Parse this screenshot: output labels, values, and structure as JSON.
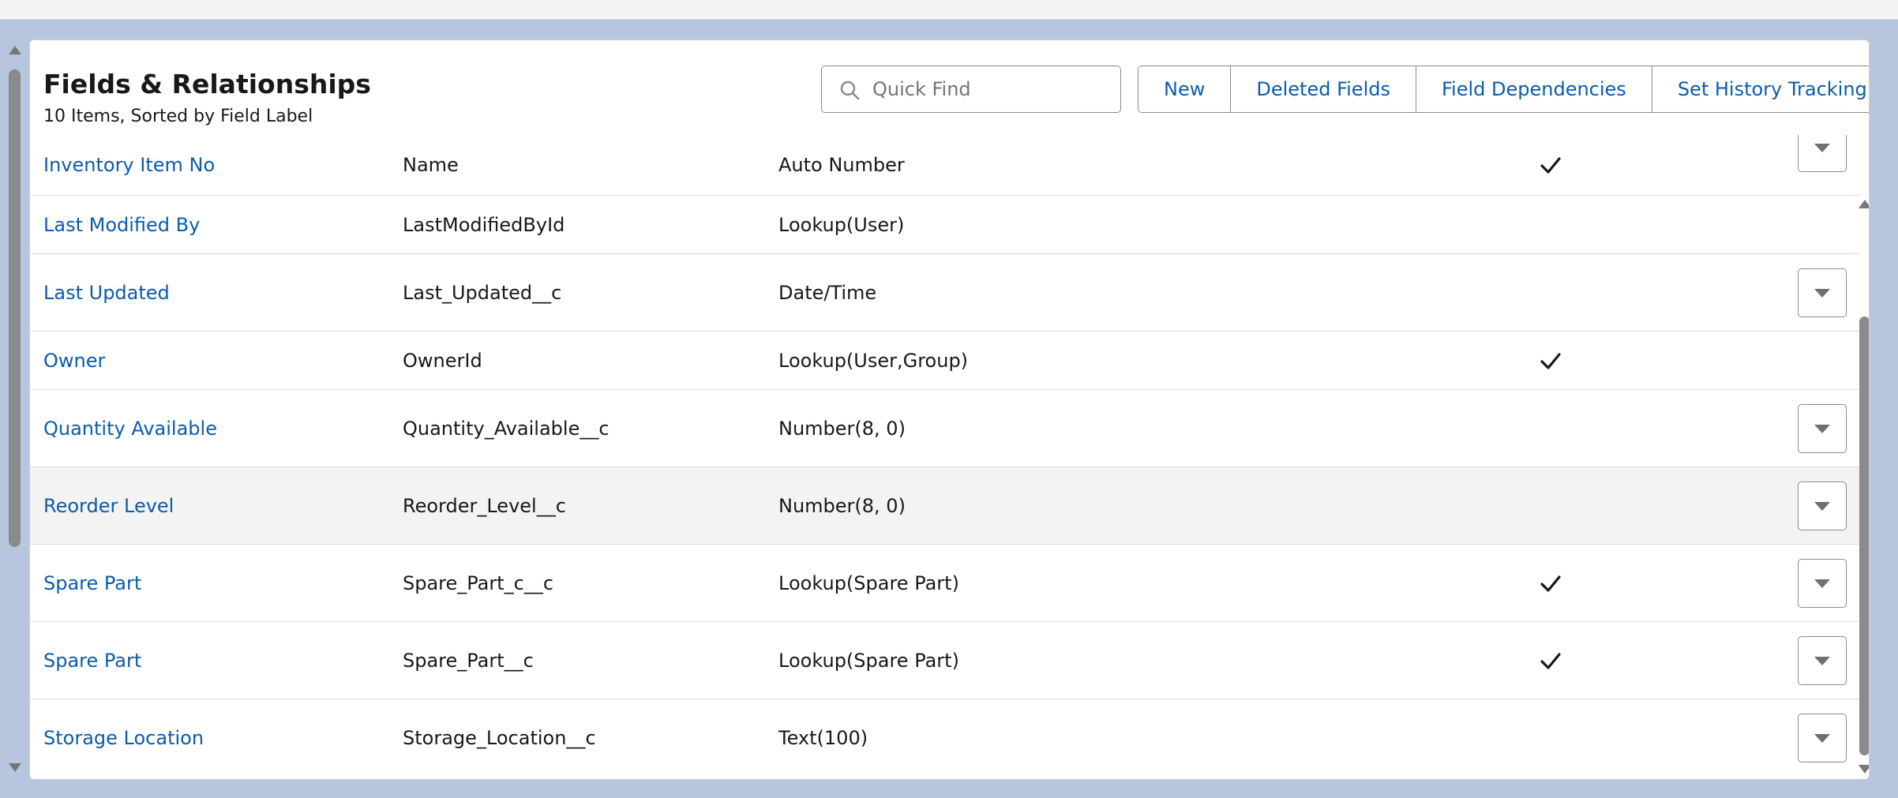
{
  "header": {
    "title": "Fields & Relationships",
    "subtitle": "10 Items, Sorted by Field Label"
  },
  "search": {
    "placeholder": "Quick Find",
    "value": ""
  },
  "buttons": {
    "new": "New",
    "deleted_fields": "Deleted Fields",
    "field_dependencies": "Field Dependencies",
    "set_history_tracking": "Set History Tracking"
  },
  "rows": [
    {
      "label": "Inventory Item No",
      "api": "Name",
      "type": "Auto Number",
      "indexed": true,
      "menu": true
    },
    {
      "label": "Last Modified By",
      "api": "LastModifiedById",
      "type": "Lookup(User)",
      "indexed": false,
      "menu": false
    },
    {
      "label": "Last Updated",
      "api": "Last_Updated__c",
      "type": "Date/Time",
      "indexed": false,
      "menu": true
    },
    {
      "label": "Owner",
      "api": "OwnerId",
      "type": "Lookup(User,Group)",
      "indexed": true,
      "menu": false
    },
    {
      "label": "Quantity Available",
      "api": "Quantity_Available__c",
      "type": "Number(8, 0)",
      "indexed": false,
      "menu": true
    },
    {
      "label": "Reorder Level",
      "api": "Reorder_Level__c",
      "type": "Number(8, 0)",
      "indexed": false,
      "menu": true
    },
    {
      "label": "Spare Part",
      "api": "Spare_Part_c__c",
      "type": "Lookup(Spare Part)",
      "indexed": true,
      "menu": true
    },
    {
      "label": "Spare Part",
      "api": "Spare_Part__c",
      "type": "Lookup(Spare Part)",
      "indexed": true,
      "menu": true
    },
    {
      "label": "Storage Location",
      "api": "Storage_Location__c",
      "type": "Text(100)",
      "indexed": false,
      "menu": true
    }
  ],
  "icons": {
    "search": "search-icon",
    "check": "check-icon",
    "row_menu": "chevron-down-icon"
  },
  "colors": {
    "link": "#0b5cab",
    "hover_row": "#f3f3f3",
    "background": "#b7c6de"
  }
}
